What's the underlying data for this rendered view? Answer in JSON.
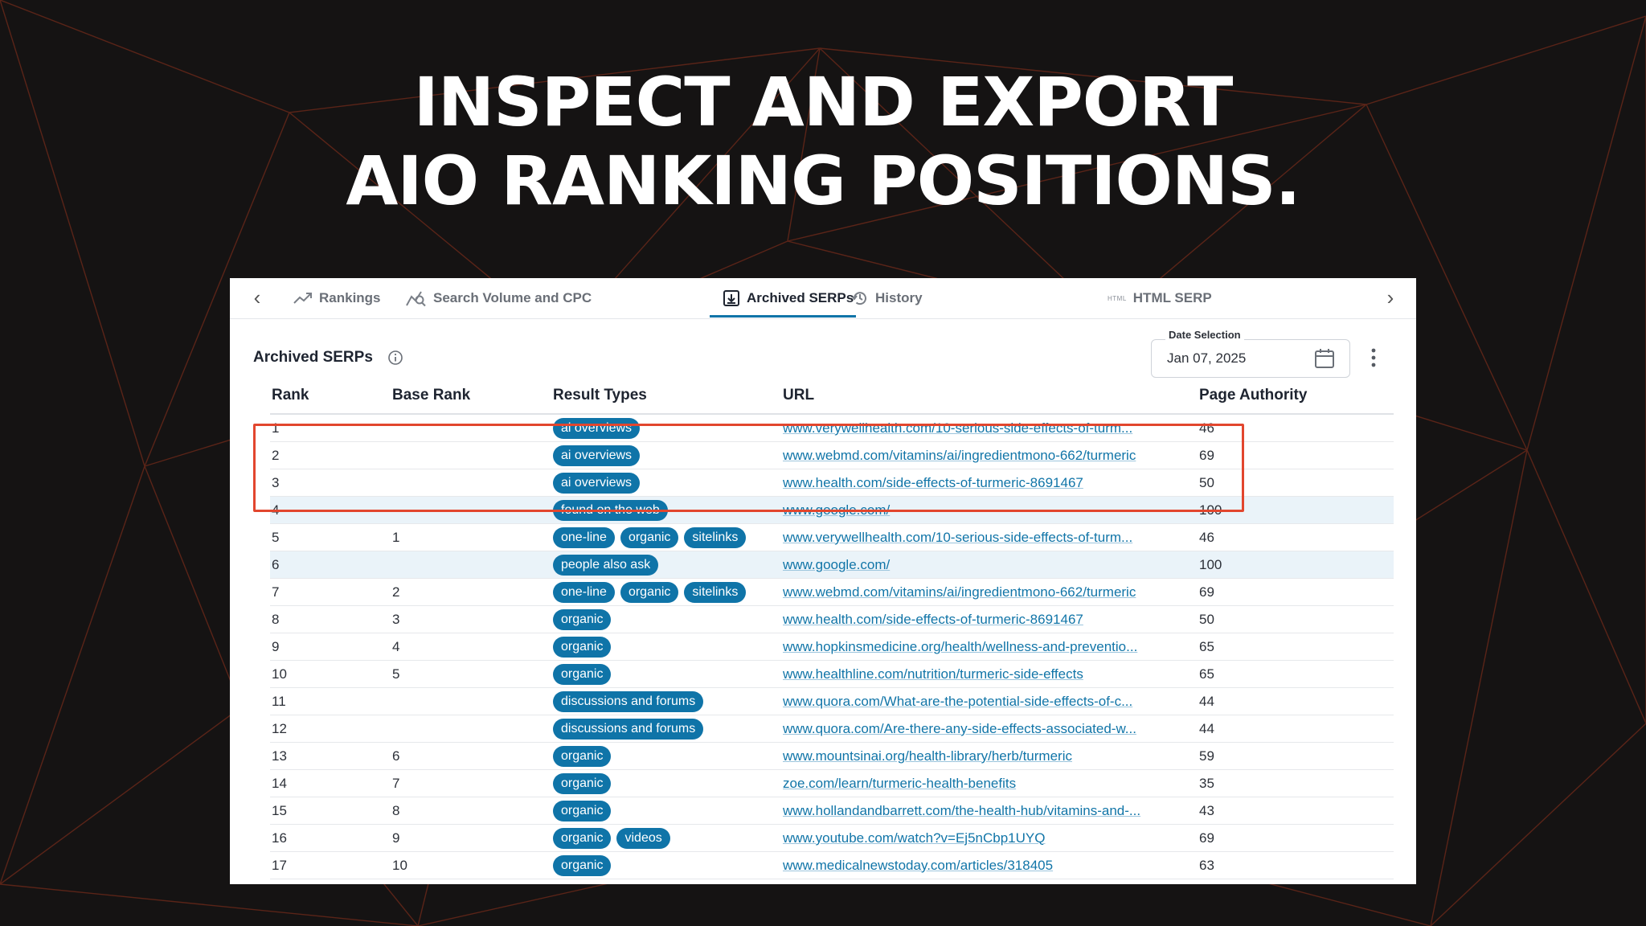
{
  "headline": {
    "line1": "INSPECT AND EXPORT",
    "line2": "AIO RANKING POSITIONS."
  },
  "colors": {
    "background": "#151313",
    "grid_lines": "#5a2418",
    "accent": "#0f74a8",
    "highlight_box": "#e2462e"
  },
  "tabs": [
    {
      "label": "Rankings",
      "icon": "trend-up-icon"
    },
    {
      "label": "Search Volume and CPC",
      "icon": "chart-search-icon"
    },
    {
      "label": "History",
      "icon": "history-icon"
    },
    {
      "label": "Archived SERPs",
      "icon": "archive-icon",
      "active": true
    },
    {
      "label": "HTML SERP",
      "icon": "html-tag-icon",
      "tag": "HTML"
    }
  ],
  "panel": {
    "title": "Archived SERPs",
    "date_label": "Date Selection",
    "date_value": "Jan 07, 2025"
  },
  "table": {
    "headers": [
      "Rank",
      "Base Rank",
      "Result Types",
      "URL",
      "Page Authority"
    ],
    "rows": [
      {
        "rank": "1",
        "base": "",
        "types": [
          "ai overviews"
        ],
        "url": "www.verywellhealth.com/10-serious-side-effects-of-turm...",
        "pa": "46",
        "boxed": true
      },
      {
        "rank": "2",
        "base": "",
        "types": [
          "ai overviews"
        ],
        "url": "www.webmd.com/vitamins/ai/ingredientmono-662/turmeric",
        "pa": "69",
        "boxed": true
      },
      {
        "rank": "3",
        "base": "",
        "types": [
          "ai overviews"
        ],
        "url": "www.health.com/side-effects-of-turmeric-8691467",
        "pa": "50",
        "boxed": true
      },
      {
        "rank": "4",
        "base": "",
        "types": [
          "found on the web"
        ],
        "url": "www.google.com/",
        "pa": "100",
        "highlight": true
      },
      {
        "rank": "5",
        "base": "1",
        "types": [
          "one-line",
          "organic",
          "sitelinks"
        ],
        "url": "www.verywellhealth.com/10-serious-side-effects-of-turm...",
        "pa": "46"
      },
      {
        "rank": "6",
        "base": "",
        "types": [
          "people also ask"
        ],
        "url": "www.google.com/",
        "pa": "100",
        "highlight": true
      },
      {
        "rank": "7",
        "base": "2",
        "types": [
          "one-line",
          "organic",
          "sitelinks"
        ],
        "url": "www.webmd.com/vitamins/ai/ingredientmono-662/turmeric",
        "pa": "69"
      },
      {
        "rank": "8",
        "base": "3",
        "types": [
          "organic"
        ],
        "url": "www.health.com/side-effects-of-turmeric-8691467",
        "pa": "50"
      },
      {
        "rank": "9",
        "base": "4",
        "types": [
          "organic"
        ],
        "url": "www.hopkinsmedicine.org/health/wellness-and-preventio...",
        "pa": "65"
      },
      {
        "rank": "10",
        "base": "5",
        "types": [
          "organic"
        ],
        "url": "www.healthline.com/nutrition/turmeric-side-effects",
        "pa": "65"
      },
      {
        "rank": "11",
        "base": "",
        "types": [
          "discussions and forums"
        ],
        "url": "www.quora.com/What-are-the-potential-side-effects-of-c...",
        "pa": "44"
      },
      {
        "rank": "12",
        "base": "",
        "types": [
          "discussions and forums"
        ],
        "url": "www.quora.com/Are-there-any-side-effects-associated-w...",
        "pa": "44"
      },
      {
        "rank": "13",
        "base": "6",
        "types": [
          "organic"
        ],
        "url": "www.mountsinai.org/health-library/herb/turmeric",
        "pa": "59"
      },
      {
        "rank": "14",
        "base": "7",
        "types": [
          "organic"
        ],
        "url": "zoe.com/learn/turmeric-health-benefits",
        "pa": "35"
      },
      {
        "rank": "15",
        "base": "8",
        "types": [
          "organic"
        ],
        "url": "www.hollandandbarrett.com/the-health-hub/vitamins-and-...",
        "pa": "43"
      },
      {
        "rank": "16",
        "base": "9",
        "types": [
          "organic",
          "videos"
        ],
        "url": "www.youtube.com/watch?v=Ej5nCbp1UYQ",
        "pa": "69"
      },
      {
        "rank": "17",
        "base": "10",
        "types": [
          "organic"
        ],
        "url": "www.medicalnewstoday.com/articles/318405",
        "pa": "63"
      }
    ]
  }
}
